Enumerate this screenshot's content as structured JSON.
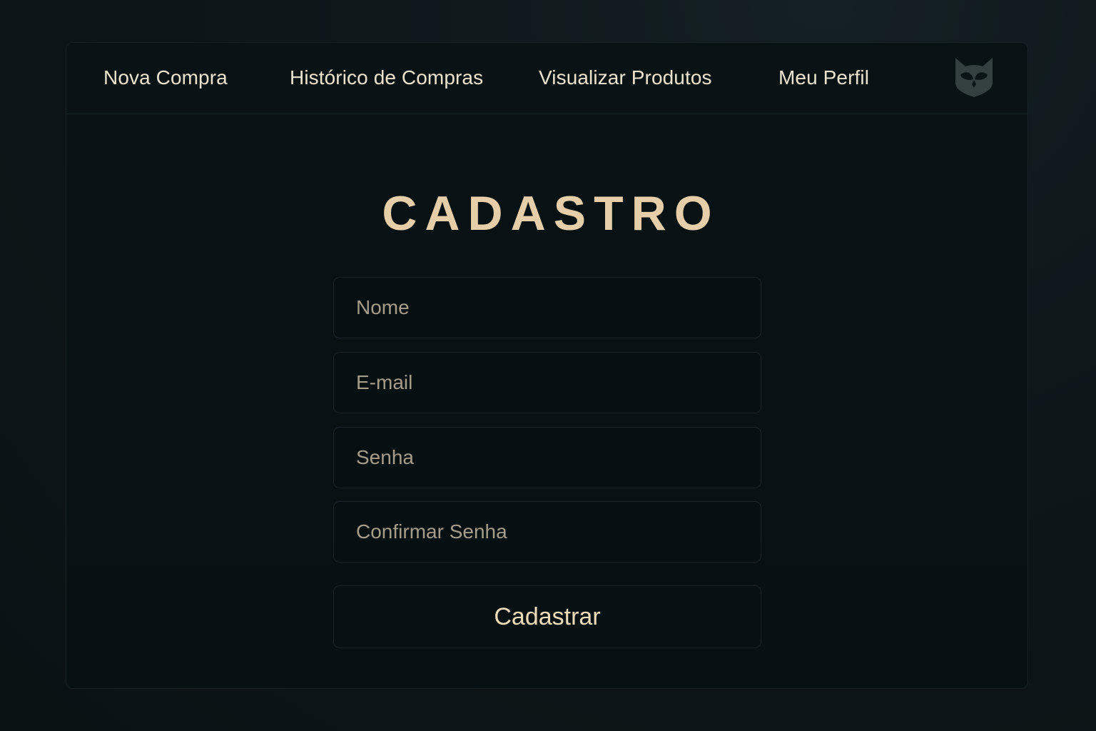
{
  "nav": {
    "items": [
      {
        "label": "Nova Compra"
      },
      {
        "label": "Histórico de Compras"
      },
      {
        "label": "Visualizar Produtos"
      },
      {
        "label": "Meu Perfil"
      }
    ],
    "logo_icon": "owl-shield-icon"
  },
  "form": {
    "title": "CADASTRO",
    "fields": [
      {
        "name": "nome",
        "value": "",
        "placeholder": "Nome"
      },
      {
        "name": "email",
        "value": "",
        "placeholder": "E-mail"
      },
      {
        "name": "senha",
        "value": "",
        "placeholder": "Senha"
      },
      {
        "name": "confirmar_senha",
        "value": "",
        "placeholder": "Confirmar Senha"
      }
    ],
    "submit_label": "Cadastrar"
  },
  "colors": {
    "background": "#0a1214",
    "panel": "#071012",
    "accent_gold": "#e6cfa8",
    "nav_text": "#ece3cf",
    "placeholder": "#a59c89",
    "border": "#19252a",
    "logo": "#34403f"
  }
}
